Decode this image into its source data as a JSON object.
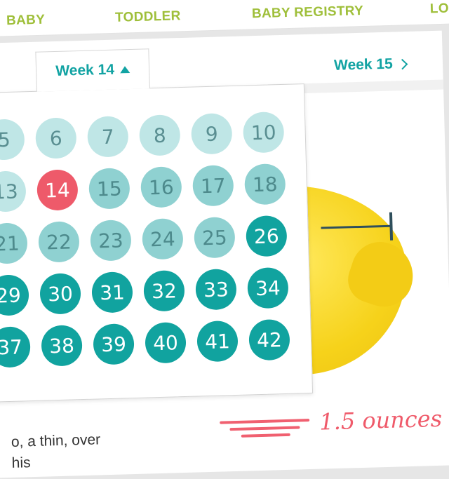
{
  "nav": {
    "items": [
      "BABY",
      "TODDLER",
      "BABY REGISTRY",
      "LO"
    ]
  },
  "week_tab": {
    "label": "Week 14"
  },
  "next_week": {
    "label": "Week 15"
  },
  "weeks": {
    "rows": [
      [
        5,
        6,
        7,
        8,
        9,
        10
      ],
      [
        13,
        14,
        15,
        16,
        17,
        18
      ],
      [
        21,
        22,
        23,
        24,
        25,
        26
      ],
      [
        29,
        30,
        31,
        32,
        33,
        34
      ],
      [
        37,
        38,
        39,
        40,
        41,
        42
      ]
    ],
    "selected": 14
  },
  "size_info": {
    "weight": "1.5 ounces"
  },
  "article": {
    "snippet": "o, a thin, over his"
  },
  "colors": {
    "nav_green": "#9fbf3a",
    "teal_text": "#12a3a3",
    "past_light": "#bfe6e6",
    "past_medium": "#8fd1d1",
    "future_dark": "#11a39f",
    "selected_red": "#ee5a6a",
    "weight_red": "#ef5a6a"
  },
  "icons": {
    "tab_caret": "caret-up-icon",
    "next_chevron": "chevron-right-icon"
  }
}
